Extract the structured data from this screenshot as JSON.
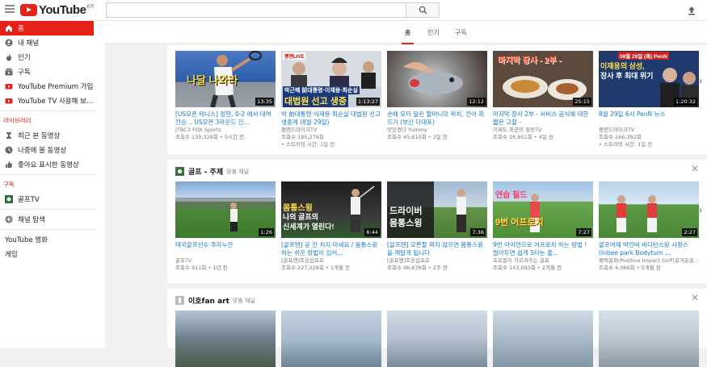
{
  "header": {
    "logo_text": "YouTube",
    "logo_region": "KR",
    "search_value": ""
  },
  "sidebar": {
    "main": [
      "홈",
      "내 채널",
      "인기",
      "구독",
      "YouTube Premium 가입",
      "YouTube TV 사용해 보..."
    ],
    "library_title": "라이브러리",
    "library": [
      "최근 본 동영상",
      "나중에 볼 동영상",
      "좋아요 표시한 동영상"
    ],
    "subs_title": "구독",
    "subs": [
      "골프TV"
    ],
    "browse": "채널 탐색",
    "movies": "YouTube 영화",
    "games": "게임"
  },
  "tabs": [
    "홈",
    "인기",
    "구독"
  ],
  "shelf1": {
    "videos": [
      {
        "title": "[US오픈 테니스] 정현, 0-2 에서 대역전승... US오픈 3라운드 진...",
        "channel": "JTBC3 FOX Sports",
        "meta": "조회수 130,329회 • 5시간 전",
        "duration": "13:35",
        "caption": "나달 나와라"
      },
      {
        "title": "박 前대통령·이재용·최순실 대법원 선고 생중계 (8월 29일)",
        "channel": "팬앤드마이크TV",
        "meta": "조회수 185,278회",
        "meta2": "• 스트리밍 시간: 1일 전",
        "duration": "1:13:27",
        "caption": "박근혜 前대통령·이재용·최순실",
        "caption2": "대법원 선고 생중",
        "live": "팬앤LIVE"
      },
      {
        "title": "손에 모터 달린 할머니의 위치, 전어 회뜨기 (부산 다대포)",
        "channel": "맛있겠다 Yummy",
        "meta": "조회수 45,610회 • 3일 전",
        "duration": "12:12"
      },
      {
        "title": "마지막 장사 2부 - 서비스 음식에 대한 짧은 고찰 -",
        "channel": "거제도 최군의 힐링TV",
        "meta": "조회수 16,951회 • 4일 전",
        "duration": "25:15",
        "caption": "마지막 장사 - 2부 -"
      },
      {
        "title": "8월 29일 6시 PenN 뉴스",
        "channel": "팬앤드마이크TV",
        "meta": "조회수 166,392회",
        "meta2": "• 스트리밍 시간: 1일 전",
        "duration": "1:20:32",
        "caption": "08월 29일 (목) PenN",
        "caption2": "이재용의 삼성,",
        "caption3": "장사 후 최대 위기"
      }
    ]
  },
  "shelf2": {
    "name": "골프 - 주제",
    "sub": "맞춤 채널",
    "videos": [
      {
        "title": "태국골프선수 주자누깐",
        "channel": "골프TV",
        "meta": "조회수 911회 • 1년 전",
        "duration": "1:26"
      },
      {
        "title": "[골프맨] 공 안 치지 마세요 / 몸통스윙하는 쉬운 방법이 있어...",
        "channel": "[골프맨]조웅섭프로",
        "meta": "조회수 227,228회 • 1개월 전",
        "duration": "6:44",
        "caption": "몸통스윙",
        "caption2": "나의 골프의",
        "caption3": "신세계가 열린다!"
      },
      {
        "title": "[골프맨] 오른팔 펴지 않으면 몸통스윙을 깨달게 됩니다",
        "channel": "[골프맨]조웅섭프로",
        "meta": "조회수 96,678회 • 2주 전",
        "duration": "7:36",
        "caption": "드라이버",
        "caption2": "몸통스윙"
      },
      {
        "title": "9번 아이언으로 어프로치 하는 방법 ! 알아두면 쉽게 5타는 줄...",
        "channel": "프로들이 가르쳐주는 골프",
        "meta": "조회수 143,093회 • 2개월 전",
        "duration": "7:27",
        "caption": "연습 필드",
        "caption2": "9번 어프로치"
      },
      {
        "title": "골프여제 박인비 바디턴스윙 시퀀스(Inbee park Bodyturn ...",
        "channel": "패택골퍼(Positive Impact Golf)골거운골...",
        "meta": "조회수 4,066회 • 5개월 전",
        "duration": "2:27"
      }
    ]
  },
  "shelf3": {
    "name": "이호fan art",
    "sub": "맞춤 채널"
  },
  "colors": {
    "accent": "#e62117",
    "link": "#167ac6"
  }
}
